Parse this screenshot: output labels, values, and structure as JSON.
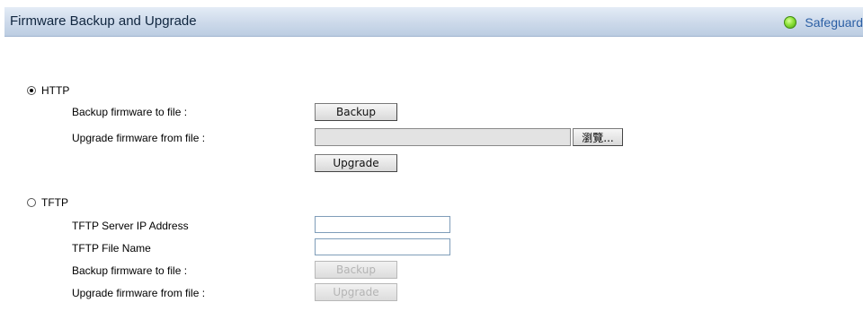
{
  "header": {
    "title": "Firmware Backup and Upgrade",
    "safeguard_label": "Safeguard",
    "safeguard_status_color": "#6fcf2a"
  },
  "http": {
    "radio_label": "HTTP",
    "selected": true,
    "backup_label": "Backup firmware to file :",
    "backup_button": "Backup",
    "upgrade_label": "Upgrade firmware from file :",
    "file_value": "",
    "browse_button": "瀏覽...",
    "upgrade_button": "Upgrade"
  },
  "tftp": {
    "radio_label": "TFTP",
    "selected": false,
    "server_ip_label": "TFTP Server IP Address",
    "server_ip_value": "",
    "file_name_label": "TFTP File Name",
    "file_name_value": "",
    "backup_label": "Backup firmware to file :",
    "backup_button": "Backup",
    "upgrade_label": "Upgrade firmware from file :",
    "upgrade_button": "Upgrade"
  }
}
